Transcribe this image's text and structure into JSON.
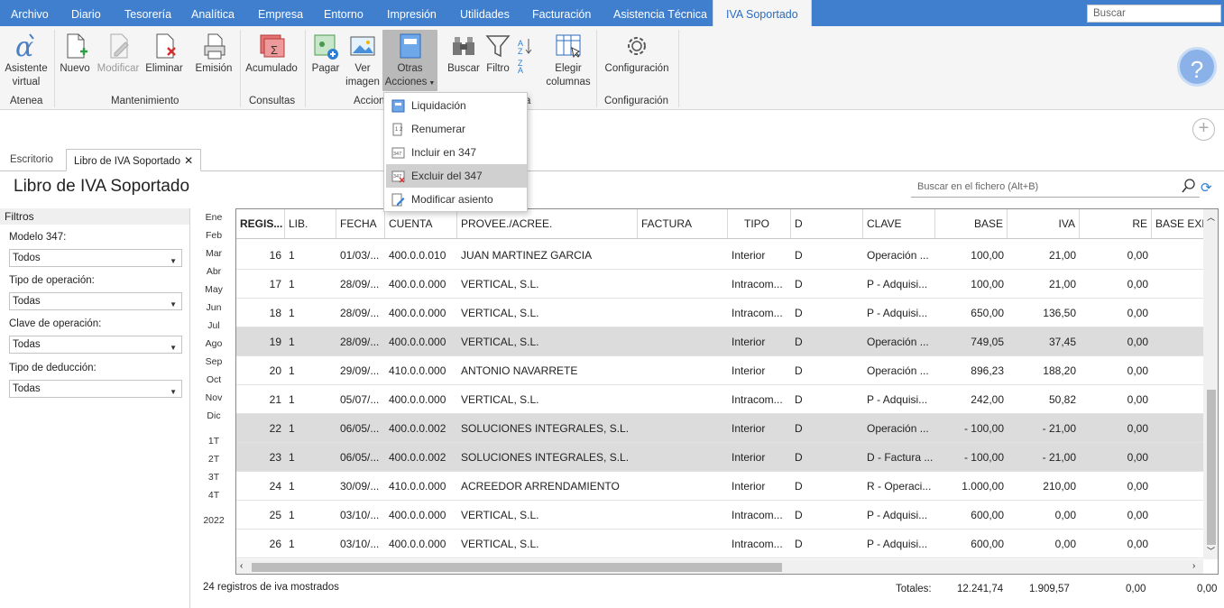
{
  "menu": {
    "items": [
      "Archivo",
      "Diario",
      "Tesorería",
      "Analítica",
      "Empresa",
      "Entorno",
      "Impresión",
      "Utilidades",
      "Facturación",
      "Asistencia Técnica"
    ],
    "active": "IVA Soportado",
    "search_placeholder": "Buscar"
  },
  "ribbon": {
    "buttons": {
      "asistente": "Asistente virtual",
      "nuevo": "Nuevo",
      "modificar": "Modificar",
      "eliminar": "Eliminar",
      "emision": "Emisión",
      "acumulado": "Acumulado",
      "pagar": "Pagar",
      "ver": "Ver imagen",
      "otras": "Otras Acciones",
      "buscar": "Buscar",
      "filtro": "Filtro",
      "elegir": "Elegir columnas",
      "config": "Configuración"
    },
    "groups": {
      "atenea": "Atenea",
      "mantenimiento": "Mantenimiento",
      "consultas": "Consultas",
      "acciones": "Accion",
      "listado": "a",
      "configuracion": "Configuración"
    }
  },
  "dropdown": {
    "items": [
      "Liquidación",
      "Renumerar",
      "Incluir en 347",
      "Excluir del 347",
      "Modificar asiento"
    ],
    "highlighted": "Excluir del 347"
  },
  "tabs": {
    "escritorio": "Escritorio",
    "libro": "Libro de IVA Soportado"
  },
  "page_title": "Libro de IVA Soportado",
  "file_search": "Buscar en el fichero (Alt+B)",
  "filters": {
    "title": "Filtros",
    "fields": [
      {
        "label": "Modelo 347:",
        "value": "Todos"
      },
      {
        "label": "Tipo de operación:",
        "value": "Todas"
      },
      {
        "label": "Clave de operación:",
        "value": "Todas"
      },
      {
        "label": "Tipo de deducción:",
        "value": "Todas"
      }
    ]
  },
  "months": [
    "Ene",
    "Feb",
    "Mar",
    "Abr",
    "May",
    "Jun",
    "Jul",
    "Ago",
    "Sep",
    "Oct",
    "Nov",
    "Dic"
  ],
  "quarters": [
    "1T",
    "2T",
    "3T",
    "4T"
  ],
  "year": "2022",
  "table": {
    "headers": [
      "REGIS...",
      "LIB.",
      "FECHA",
      "CUENTA",
      "PROVEE./ACREE.",
      "FACTURA",
      "TIPO",
      "D",
      "CLAVE",
      "BASE",
      "IVA",
      "RE",
      "BASE EXEN"
    ],
    "rows": [
      [
        "16",
        "1",
        "01/03/...",
        "400.0.0.010",
        "JUAN MARTINEZ GARCIA",
        "",
        "Interior",
        "D",
        "Operación ...",
        "100,00",
        "21,00",
        "0,00"
      ],
      [
        "17",
        "1",
        "28/09/...",
        "400.0.0.000",
        "VERTICAL, S.L.",
        "",
        "Intracom...",
        "D",
        "P - Adquisi...",
        "100,00",
        "21,00",
        "0,00"
      ],
      [
        "18",
        "1",
        "28/09/...",
        "400.0.0.000",
        "VERTICAL, S.L.",
        "",
        "Intracom...",
        "D",
        "P - Adquisi...",
        "650,00",
        "136,50",
        "0,00"
      ],
      [
        "19",
        "1",
        "28/09/...",
        "400.0.0.000",
        "VERTICAL, S.L.",
        "",
        "Interior",
        "D",
        "Operación ...",
        "749,05",
        "37,45",
        "0,00"
      ],
      [
        "20",
        "1",
        "29/09/...",
        "410.0.0.000",
        "ANTONIO NAVARRETE",
        "",
        "Interior",
        "D",
        "Operación ...",
        "896,23",
        "188,20",
        "0,00"
      ],
      [
        "21",
        "1",
        "05/07/...",
        "400.0.0.000",
        "VERTICAL, S.L.",
        "",
        "Intracom...",
        "D",
        "P - Adquisi...",
        "242,00",
        "50,82",
        "0,00"
      ],
      [
        "22",
        "1",
        "06/05/...",
        "400.0.0.002",
        "SOLUCIONES INTEGRALES, S.L.",
        "",
        "Interior",
        "D",
        "Operación ...",
        "- 100,00",
        "- 21,00",
        "0,00"
      ],
      [
        "23",
        "1",
        "06/05/...",
        "400.0.0.002",
        "SOLUCIONES INTEGRALES, S.L.",
        "",
        "Interior",
        "D",
        "D - Factura ...",
        "- 100,00",
        "- 21,00",
        "0,00"
      ],
      [
        "24",
        "1",
        "30/09/...",
        "410.0.0.000",
        "ACREEDOR ARRENDAMIENTO",
        "",
        "Interior",
        "D",
        "R - Operaci...",
        "1.000,00",
        "210,00",
        "0,00"
      ],
      [
        "25",
        "1",
        "03/10/...",
        "400.0.0.000",
        "VERTICAL, S.L.",
        "",
        "Intracom...",
        "D",
        "P - Adquisi...",
        "600,00",
        "0,00",
        "0,00"
      ],
      [
        "26",
        "1",
        "03/10/...",
        "400.0.0.000",
        "VERTICAL, S.L.",
        "",
        "Intracom...",
        "D",
        "P - Adquisi...",
        "600,00",
        "0,00",
        "0,00"
      ]
    ],
    "selected_rows": [
      "19",
      "22",
      "23"
    ]
  },
  "footer": {
    "count": "24 registros de iva mostrados",
    "totals_label": "Totales:",
    "base": "12.241,74",
    "iva": "1.909,57",
    "re": "0,00",
    "exen": "0,00"
  },
  "colors": {
    "menubar": "#3f7fce",
    "accent": "#2c7fd6",
    "selected_row": "#dcdcdc"
  }
}
